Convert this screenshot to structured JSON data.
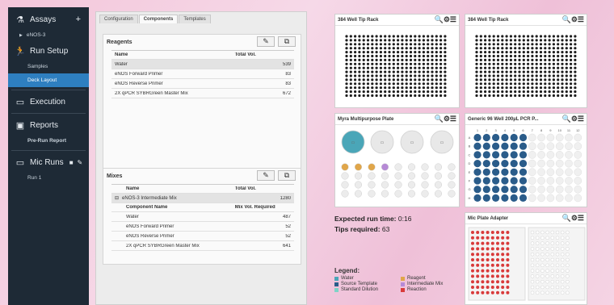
{
  "colors": {
    "water": "#4aa6b8",
    "source": "#2a5c8a",
    "standard": "#7fd3c7",
    "reagent": "#e0a64a",
    "intermediate": "#b68ad6",
    "reaction": "#d93a3a",
    "active_nav": "#2e7fc0"
  },
  "sidebar": {
    "assays_label": "Assays",
    "add_icon": "plus-icon",
    "assay_item": "eNOS-3",
    "run_setup_label": "Run Setup",
    "samples_label": "Samples",
    "deck_layout_label": "Deck Layout",
    "execution_label": "Execution",
    "reports_label": "Reports",
    "pre_run_report_label": "Pre-Run Report",
    "mic_runs_label": "Mic Runs",
    "run1_label": "Run 1"
  },
  "tabs": [
    {
      "label": "Configuration"
    },
    {
      "label": "Components"
    },
    {
      "label": "Templates"
    }
  ],
  "reagents": {
    "title": "Reagents",
    "col_name": "Name",
    "col_total": "Total Vol.",
    "rows": [
      {
        "name": "Water",
        "vol": "539"
      },
      {
        "name": "eNOS Forward Primer",
        "vol": "83"
      },
      {
        "name": "eNOS Reverse Primer",
        "vol": "83"
      },
      {
        "name": "2X qPCR SYBRGreen Master Mix",
        "vol": "672"
      }
    ]
  },
  "mixes": {
    "title": "Mixes",
    "col_name": "Name",
    "col_total": "Total Vol.",
    "mix_name": "eNOS-3 Intermediate Mix",
    "mix_vol": "1280",
    "comp_col_name": "Component Name",
    "comp_col_vol": "Mix Vol. Required",
    "components": [
      {
        "name": "Water",
        "vol": "487"
      },
      {
        "name": "eNOS Forward Primer",
        "vol": "52"
      },
      {
        "name": "eNOS Reverse Primer",
        "vol": "52"
      },
      {
        "name": "2X qPCR SYBRGreen Master Mix",
        "vol": "641"
      }
    ]
  },
  "cards": {
    "tip1": "384 Well Tip Rack",
    "tip2": "384 Well Tip Rack",
    "myra": "Myra Multipurpose Plate",
    "generic": "Generic 96 Well 200µL PCR P...",
    "mic": "Mic Plate Adapter"
  },
  "run_info": {
    "expected_label": "Expected run time:",
    "expected_value": "0:16",
    "tips_label": "Tips required:",
    "tips_value": "63"
  },
  "generic_cols": [
    "1",
    "2",
    "3",
    "4",
    "5",
    "6",
    "7",
    "8",
    "9",
    "10",
    "11",
    "12"
  ],
  "generic_rows": [
    "A",
    "B",
    "C",
    "D",
    "E",
    "F",
    "G",
    "H"
  ],
  "generic_filled_cols": 6,
  "legend": {
    "title": "Legend:",
    "items": [
      {
        "label": "Water",
        "color_key": "water"
      },
      {
        "label": "Reagent",
        "color_key": "reagent"
      },
      {
        "label": "Source Template",
        "color_key": "source"
      },
      {
        "label": "Intermediate Mix",
        "color_key": "intermediate"
      },
      {
        "label": "Standard Dilution",
        "color_key": "standard"
      },
      {
        "label": "Reaction",
        "color_key": "reaction"
      }
    ]
  }
}
